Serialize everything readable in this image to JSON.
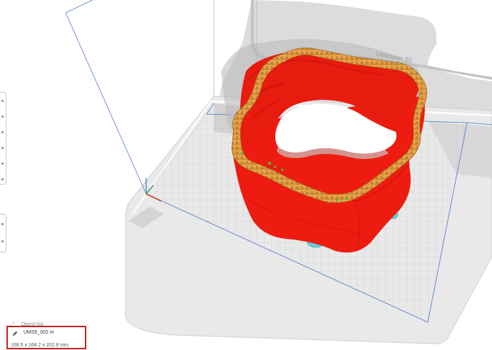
{
  "viewport": {
    "printer_name": "UltiMaker S5",
    "colors": {
      "model_fill": "#ee1c10",
      "model_dark": "#b80f08",
      "wall_orange": "#e8a247",
      "infill_green": "#33cc44",
      "support_cyan": "#5fd0d8",
      "build_plate": "#e6e6e6",
      "grid_line": "#c8c8c8",
      "volume_line": "#4b78c8"
    },
    "axes_icons": [
      "x-axis-icon",
      "y-axis-icon",
      "z-axis-icon"
    ]
  },
  "object_list": {
    "header": "Object list",
    "items": [
      {
        "name": "UMS5_002 in",
        "dimensions": "168.5 x 168.2 x 202.8 mm"
      }
    ]
  },
  "left_toolbar": {
    "tools": [
      "move-tool",
      "scale-tool",
      "rotate-tool",
      "mirror-tool",
      "per-model-settings-tool",
      "support-blocker-tool"
    ]
  }
}
